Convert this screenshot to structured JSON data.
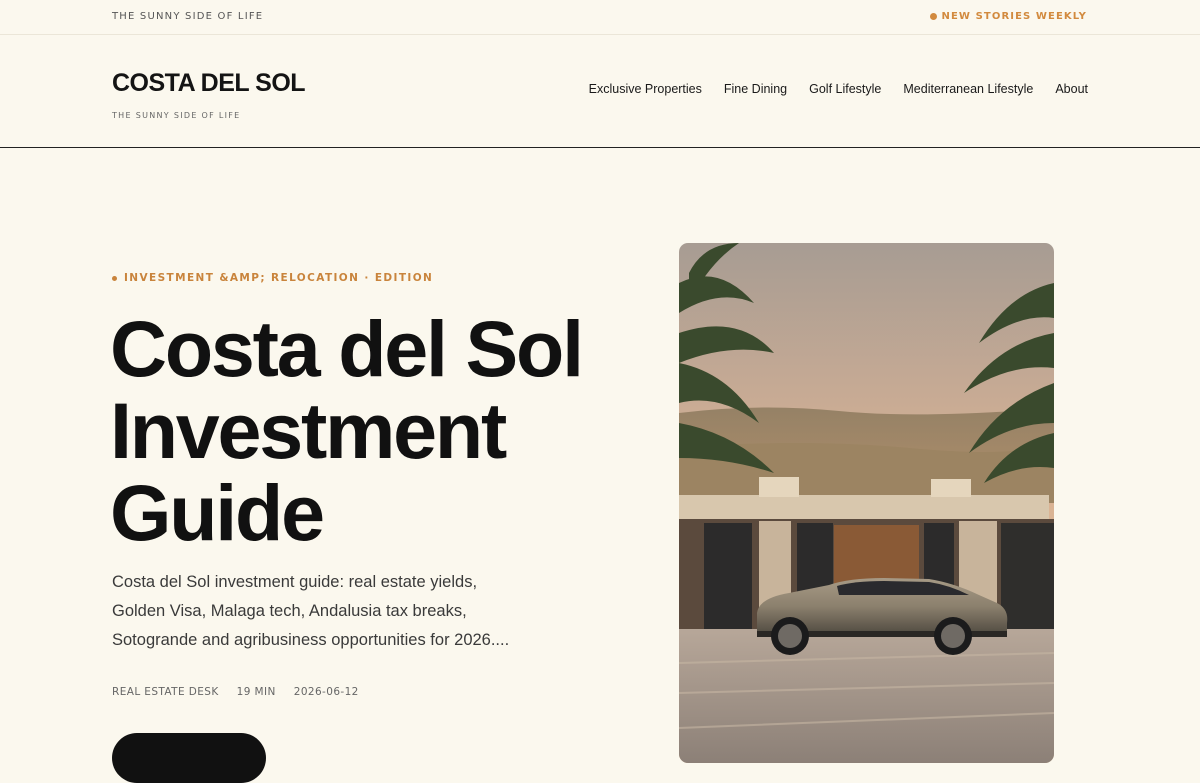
{
  "topbar": {
    "tagline": "THE SUNNY SIDE OF LIFE",
    "news": "NEW STORIES WEEKLY"
  },
  "header": {
    "logo": "COSTA DEL SOL",
    "sub": "THE SUNNY SIDE OF LIFE",
    "nav": [
      "Exclusive Properties",
      "Fine Dining",
      "Golf Lifestyle",
      "Mediterranean Lifestyle",
      "About"
    ]
  },
  "hero": {
    "kicker": "INVESTMENT &AMP; RELOCATION · EDITION",
    "headline": "Costa del Sol Investment Guide",
    "excerpt": "Costa del Sol investment guide: real estate yields, Golden Visa, Malaga tech, Andalusia tax breaks, Sotogrande and agribusiness opportunities for 2026....",
    "meta": {
      "category": "REAL ESTATE DESK",
      "read_time": "19 MIN",
      "date": "2026-06-12"
    },
    "image_alt": "Luxury car parked in front of a modern villa flanked by palm trees at sunset"
  },
  "colors": {
    "background": "#fbf8ee",
    "accent": "#d28a3e",
    "text": "#141414"
  }
}
